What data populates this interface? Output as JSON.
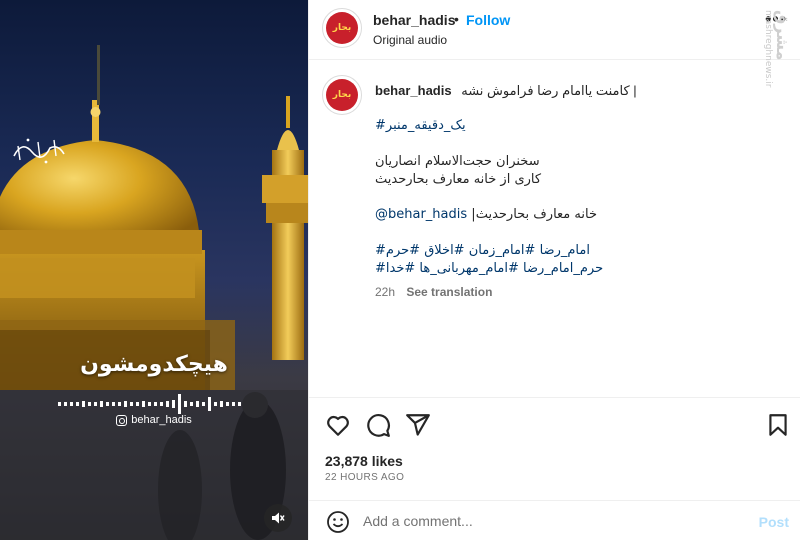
{
  "media": {
    "overlay_title": "هیچکدومشون",
    "overlay_handle": "behar_hadis",
    "logo_text": "بحارحدیث",
    "mute_icon": "speaker-muted-icon"
  },
  "header": {
    "username": "behar_hadis",
    "separator": "•",
    "follow_label": "Follow",
    "audio_label": "Original audio",
    "more_label": "•••",
    "avatar_text": "بحار"
  },
  "watermark": {
    "line1": "مشرق",
    "line2": "mashreghnews.ir"
  },
  "caption": {
    "username": "behar_hadis",
    "line1": "کامنت یاامام رضا فراموش نشه |",
    "hashtag_minbar": "#یک_دقیقه_منبر",
    "speaker": "سخنران حجت‌الاسلام انصاریان",
    "production": "کاری از خانه معارف بحارحدیث",
    "mention_suffix": "|خانه معارف بحارحدیث",
    "mention": "@behar_hadis",
    "hashtags_line1": "#امام_رضا #امام_زمان #اخلاق #حرم",
    "hashtags_line2": "#حرم_امام_رضا #امام_مهربانی_ها #خدا",
    "time": "22h",
    "see_translation": "See translation"
  },
  "actions": {
    "like_icon": "heart-icon",
    "comment_icon": "comment-icon",
    "share_icon": "share-icon",
    "save_icon": "bookmark-icon",
    "likes": "23,878 likes",
    "posted": "22 HOURS AGO"
  },
  "comment_bar": {
    "emoji_icon": "emoji-icon",
    "placeholder": "Add a comment...",
    "post_label": "Post"
  },
  "colors": {
    "accent": "#0095f6",
    "link": "#00376b",
    "muted": "#737373",
    "post_disabled": "#b2dffc",
    "gold": "#d9a520"
  }
}
